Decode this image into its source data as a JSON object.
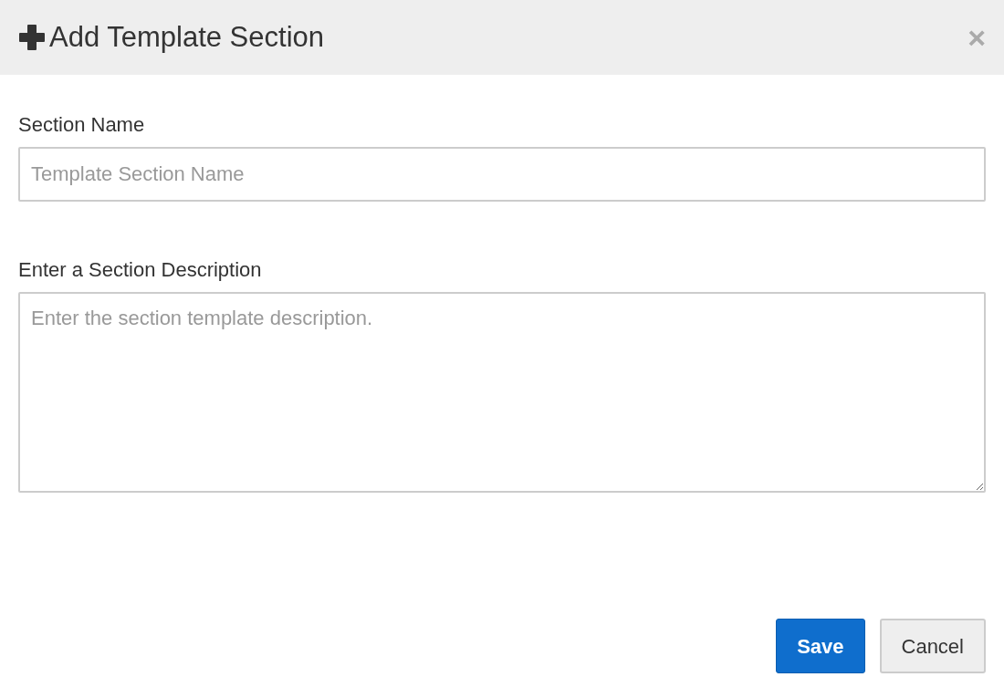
{
  "dialog": {
    "title": "Add Template Section",
    "close": "×"
  },
  "fields": [
    {
      "kind": "input",
      "label": "Section Name",
      "placeholder": "Template Section Name"
    },
    {
      "kind": "textarea",
      "label": "Enter a Section Description",
      "placeholder": "Enter the section template description."
    }
  ],
  "buttons": [
    {
      "label": "Save",
      "kind": "primary"
    },
    {
      "label": "Cancel",
      "kind": "secondary"
    }
  ]
}
